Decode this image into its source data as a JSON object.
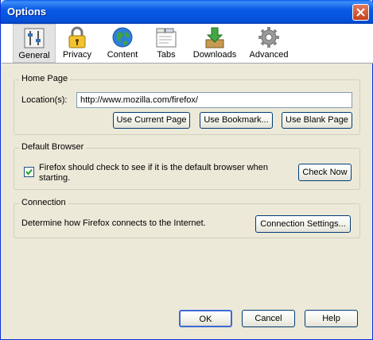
{
  "window": {
    "title": "Options"
  },
  "toolbar": {
    "tabs": [
      {
        "label": "General",
        "icon": "general-icon",
        "selected": true
      },
      {
        "label": "Privacy",
        "icon": "privacy-lock-icon",
        "selected": false
      },
      {
        "label": "Content",
        "icon": "content-globe-icon",
        "selected": false
      },
      {
        "label": "Tabs",
        "icon": "tabs-icon",
        "selected": false
      },
      {
        "label": "Downloads",
        "icon": "downloads-icon",
        "selected": false
      },
      {
        "label": "Advanced",
        "icon": "advanced-gear-icon",
        "selected": false
      }
    ]
  },
  "home_page": {
    "title": "Home Page",
    "location_label": "Location(s):",
    "location_value": "http://www.mozilla.com/firefox/",
    "use_current": "Use Current Page",
    "use_bookmark": "Use Bookmark...",
    "use_blank": "Use Blank Page"
  },
  "default_browser": {
    "title": "Default Browser",
    "check_text_line1": "Firefox should check to see if it is the default browser when",
    "check_text_line2": "starting.",
    "checked": true,
    "check_now": "Check Now"
  },
  "connection": {
    "title": "Connection",
    "description": "Determine how Firefox connects to the Internet.",
    "settings_button": "Connection Settings..."
  },
  "footer": {
    "ok": "OK",
    "cancel": "Cancel",
    "help": "Help"
  },
  "colors": {
    "accent": "#0a5ae6",
    "face": "#ece9d8",
    "button_border": "#003c74"
  }
}
